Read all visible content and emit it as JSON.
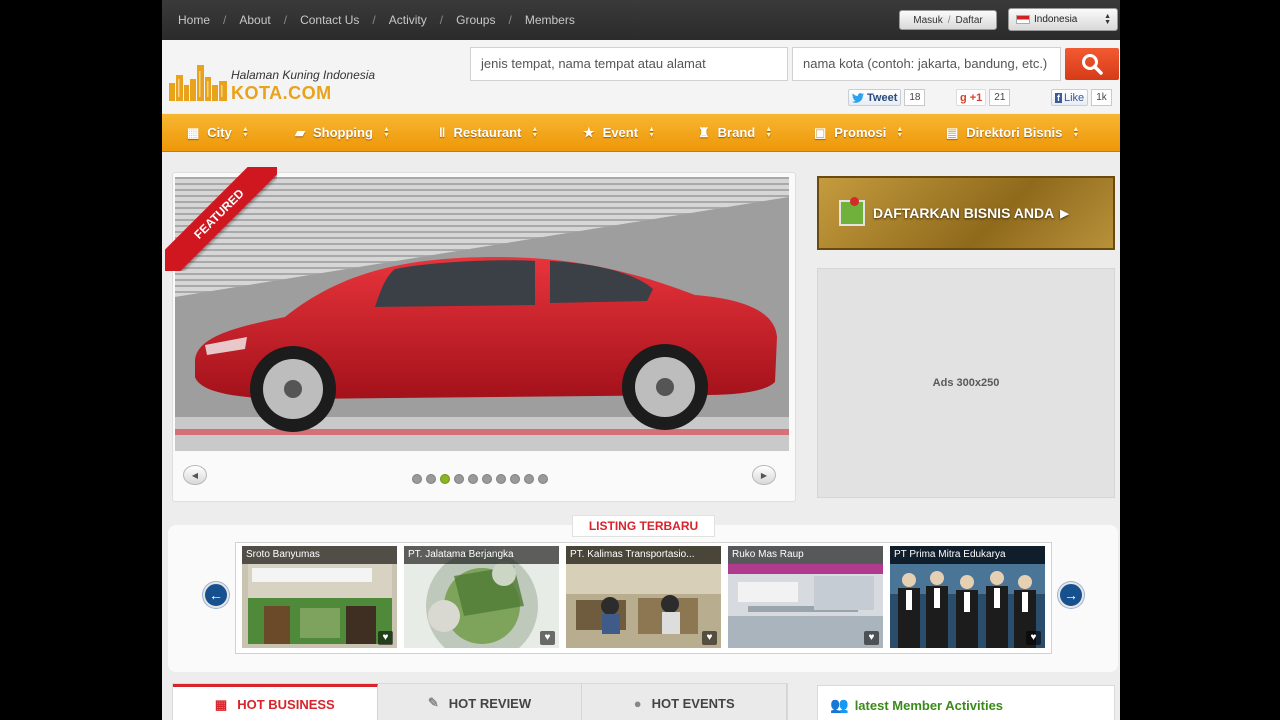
{
  "topnav": {
    "links": [
      "Home",
      "About",
      "Contact Us",
      "Activity",
      "Groups",
      "Members"
    ],
    "sep": "/",
    "login": "Masuk",
    "register": "Daftar",
    "language": "Indonesia"
  },
  "header": {
    "logo_tagline": "Halaman Kuning Indonesia",
    "logo_brand": "KOTA.COM",
    "search_what": "jenis tempat, nama tempat atau alamat",
    "search_city": "nama kota (contoh: jakarta, bandung, etc.)",
    "tweet_label": "Tweet",
    "tweet_count": "18",
    "gplus_label": "+1",
    "gplus_count": "21",
    "like_label": "Like",
    "like_count": "1k"
  },
  "mainnav": {
    "items": [
      "City",
      "Shopping",
      "Restaurant",
      "Event",
      "Brand",
      "Promosi",
      "Direktori Bisnis"
    ]
  },
  "slider": {
    "ribbon": "FEATURED",
    "slide_count": 10,
    "active_slide": 3
  },
  "sidebar": {
    "register_banner": "DAFTARKAN BISNIS ANDA",
    "ads_label": "Ads 300x250",
    "member_title": "latest Member Activities"
  },
  "listing": {
    "title": "LISTING TERBARU",
    "items": [
      {
        "name": "Sroto Banyumas"
      },
      {
        "name": "PT. Jalatama Berjangka"
      },
      {
        "name": "PT. Kalimas Transportasio..."
      },
      {
        "name": "Ruko Mas Raup"
      },
      {
        "name": "PT Prima Mitra Edukarya"
      }
    ]
  },
  "tabs": [
    "HOT BUSINESS",
    "HOT REVIEW",
    "HOT EVENTS"
  ],
  "colors": {
    "nav_orange": "#f0a018",
    "accent_red": "#d9232b",
    "search_button": "#e84a22"
  }
}
